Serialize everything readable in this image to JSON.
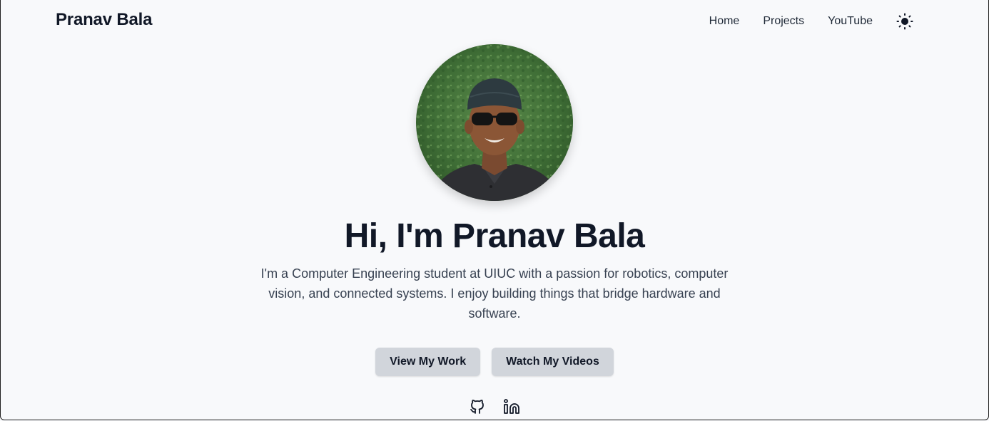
{
  "header": {
    "brand": "Pranav Bala",
    "nav": [
      {
        "label": "Home"
      },
      {
        "label": "Projects"
      },
      {
        "label": "YouTube"
      }
    ],
    "theme_toggle_icon": "sun-icon"
  },
  "hero": {
    "avatar_alt": "Pranav Bala",
    "headline": "Hi, I'm Pranav Bala",
    "bio": "I'm a Computer Engineering student at UIUC with a passion for robotics, computer vision, and connected systems. I enjoy building things that bridge hardware and software.",
    "buttons": [
      {
        "label": "View My Work"
      },
      {
        "label": "Watch My Videos"
      }
    ],
    "socials": [
      {
        "icon": "github-icon"
      },
      {
        "icon": "linkedin-icon"
      }
    ]
  },
  "colors": {
    "background": "#f8f9fb",
    "text": "#111827",
    "button_bg": "#d1d5db",
    "avatar_bg": "#3d6b35"
  }
}
